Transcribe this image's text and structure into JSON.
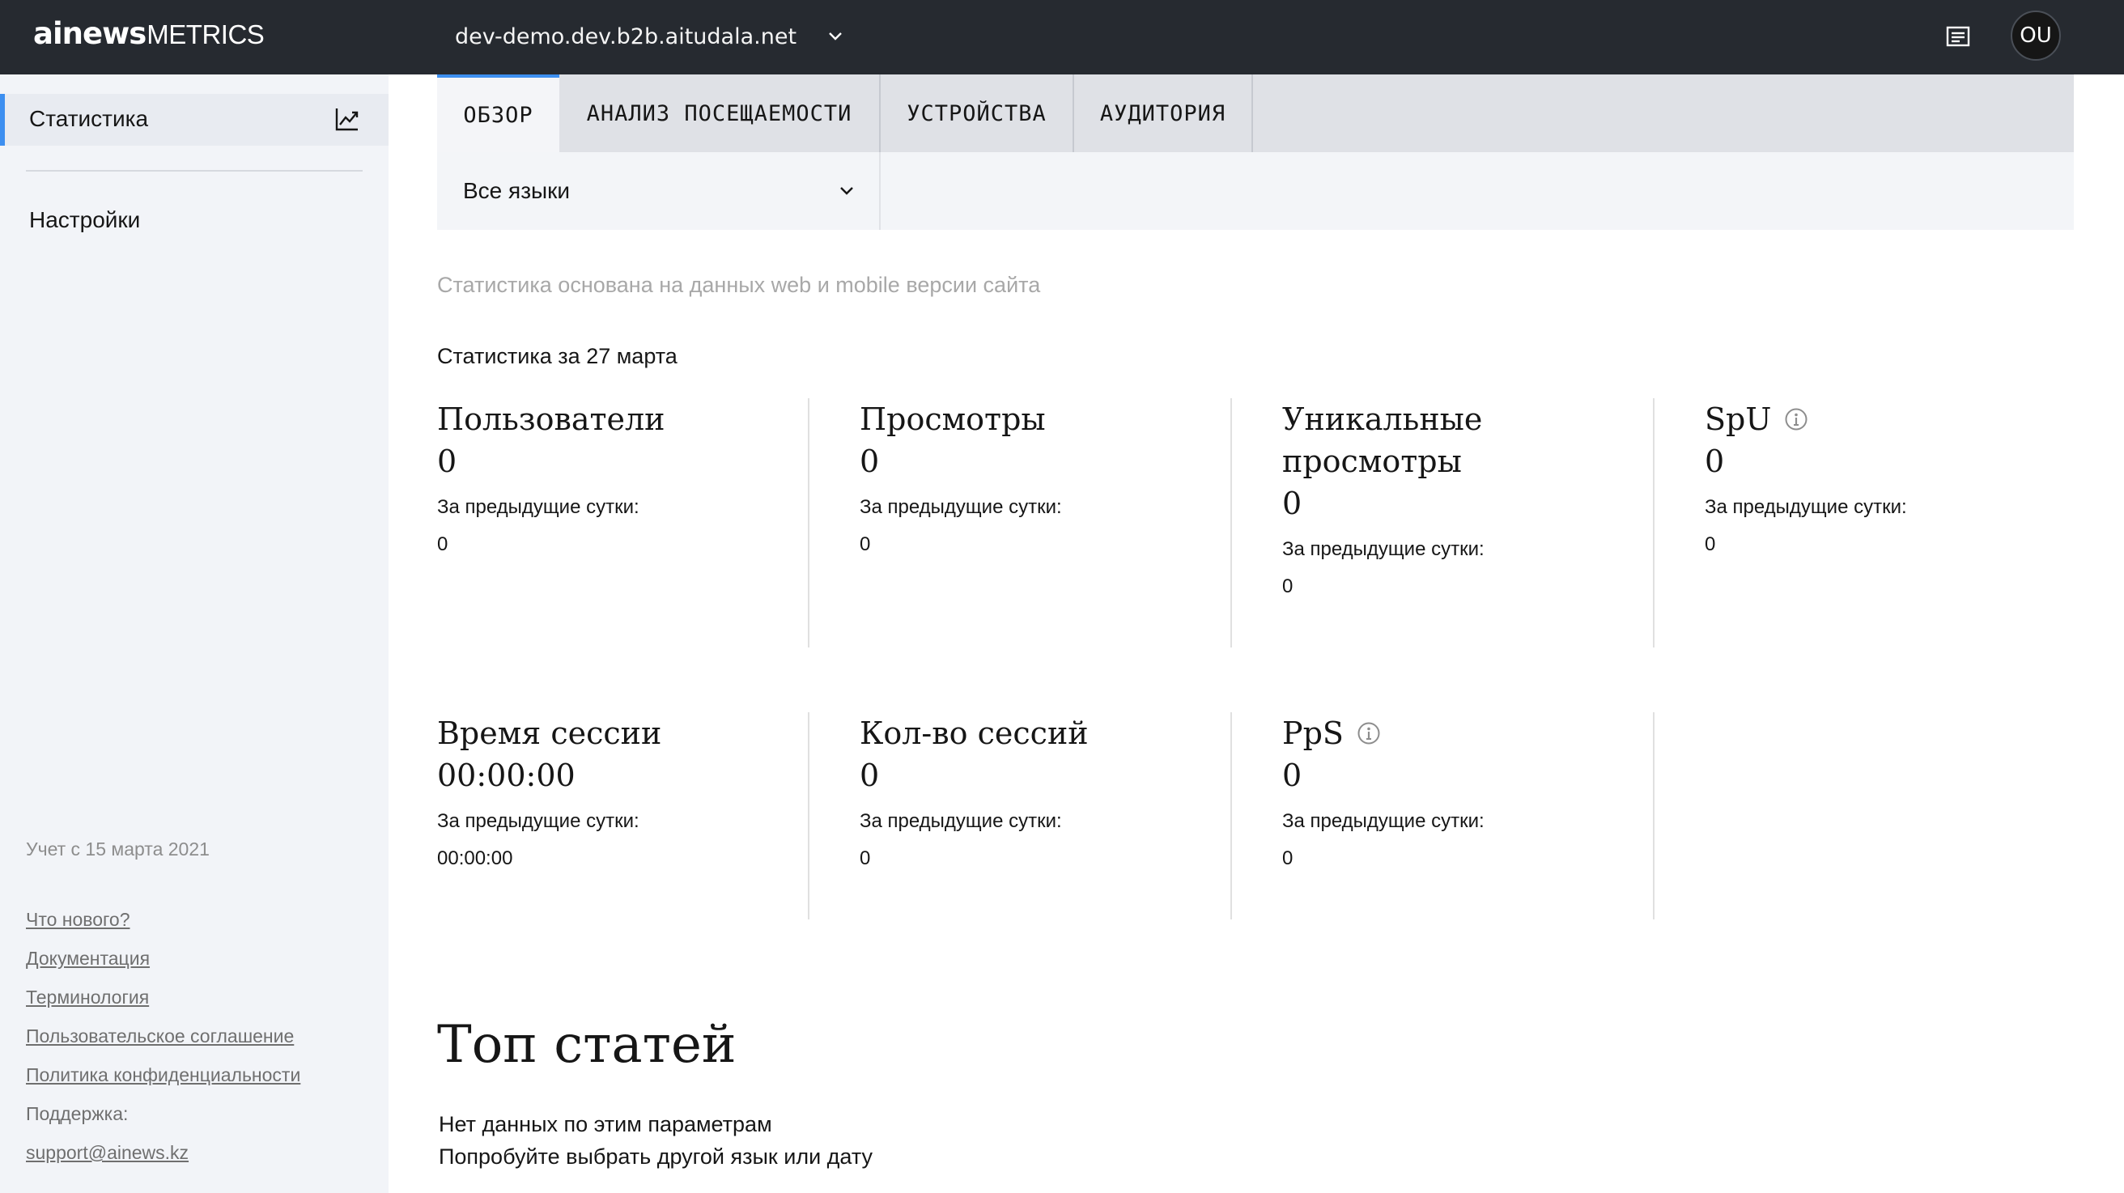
{
  "header": {
    "logo_main": "ainews",
    "logo_sub": "METRICS",
    "site": "dev-demo.dev.b2b.aitudala.net",
    "avatar_initials": "OU"
  },
  "sidebar": {
    "items": [
      {
        "label": "Статистика",
        "icon": "chart-line-icon",
        "active": true
      },
      {
        "label": "Настройки",
        "active": false
      }
    ],
    "since": "Учет с 15 марта 2021",
    "links": [
      "Что нового?",
      "Документация",
      "Терминология",
      "Пользовательское соглашение",
      "Политика конфиденциальности"
    ],
    "support_label": "Поддержка:",
    "support_email": "support@ainews.kz"
  },
  "tabs": [
    "ОБЗОР",
    "АНАЛИЗ ПОСЕЩАЕМОСТИ",
    "УСТРОЙСТВА",
    "АУДИТОРИЯ"
  ],
  "filters": {
    "language": "Все языки"
  },
  "note": "Статистика основана на данных web и mobile версии сайта",
  "stats_date": "Статистика за 27 марта",
  "prev_label": "За предыдущие сутки:",
  "metrics": [
    {
      "title": "Пользователи",
      "value": "0",
      "prev": "0"
    },
    {
      "title": "Просмотры",
      "value": "0",
      "prev": "0"
    },
    {
      "title": "Уникальные просмотры",
      "value": "0",
      "prev": "0"
    },
    {
      "title": "SpU",
      "value": "0",
      "prev": "0",
      "info": true
    },
    {
      "title": "Время сессии",
      "value": "00:00:00",
      "prev": "00:00:00"
    },
    {
      "title": "Кол-во сессий",
      "value": "0",
      "prev": "0"
    },
    {
      "title": "PpS",
      "value": "0",
      "prev": "0",
      "info": true
    }
  ],
  "top": {
    "title": "Топ статей",
    "empty_line1": "Нет данных по этим параметрам",
    "empty_line2": "Попробуйте выбрать другой язык или дату"
  },
  "colors": {
    "topbar": "#262a30",
    "accent": "#3d8ff0",
    "sidebar": "#f2f4f8"
  }
}
